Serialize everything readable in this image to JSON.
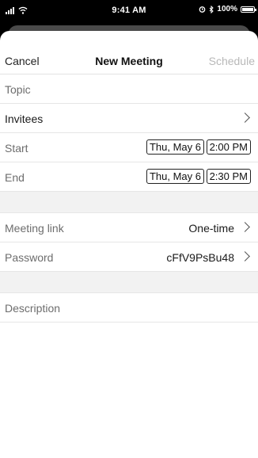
{
  "status_bar": {
    "time": "9:41 AM",
    "battery_text": "100%",
    "battery_level": 1.0,
    "icons": [
      "signal-icon",
      "wifi-icon",
      "alarm-icon",
      "bluetooth-icon",
      "battery-icon"
    ]
  },
  "nav": {
    "cancel_label": "Cancel",
    "title": "New Meeting",
    "schedule_label": "Schedule"
  },
  "form": {
    "topic_placeholder": "Topic",
    "invitees_label": "Invitees",
    "start_label": "Start",
    "start_date": "Thu, May 6",
    "start_time": "2:00 PM",
    "end_label": "End",
    "end_date": "Thu, May 6",
    "end_time": "2:30 PM",
    "meeting_link_label": "Meeting link",
    "meeting_link_value": "One-time",
    "password_label": "Password",
    "password_value": "cFfV9PsBu48",
    "description_placeholder": "Description"
  },
  "colors": {
    "background": "#000000",
    "sheet": "#ffffff",
    "label_gray": "#6d6d6d",
    "disabled": "#b8b8b8",
    "section_gap": "#f2f2f2"
  }
}
